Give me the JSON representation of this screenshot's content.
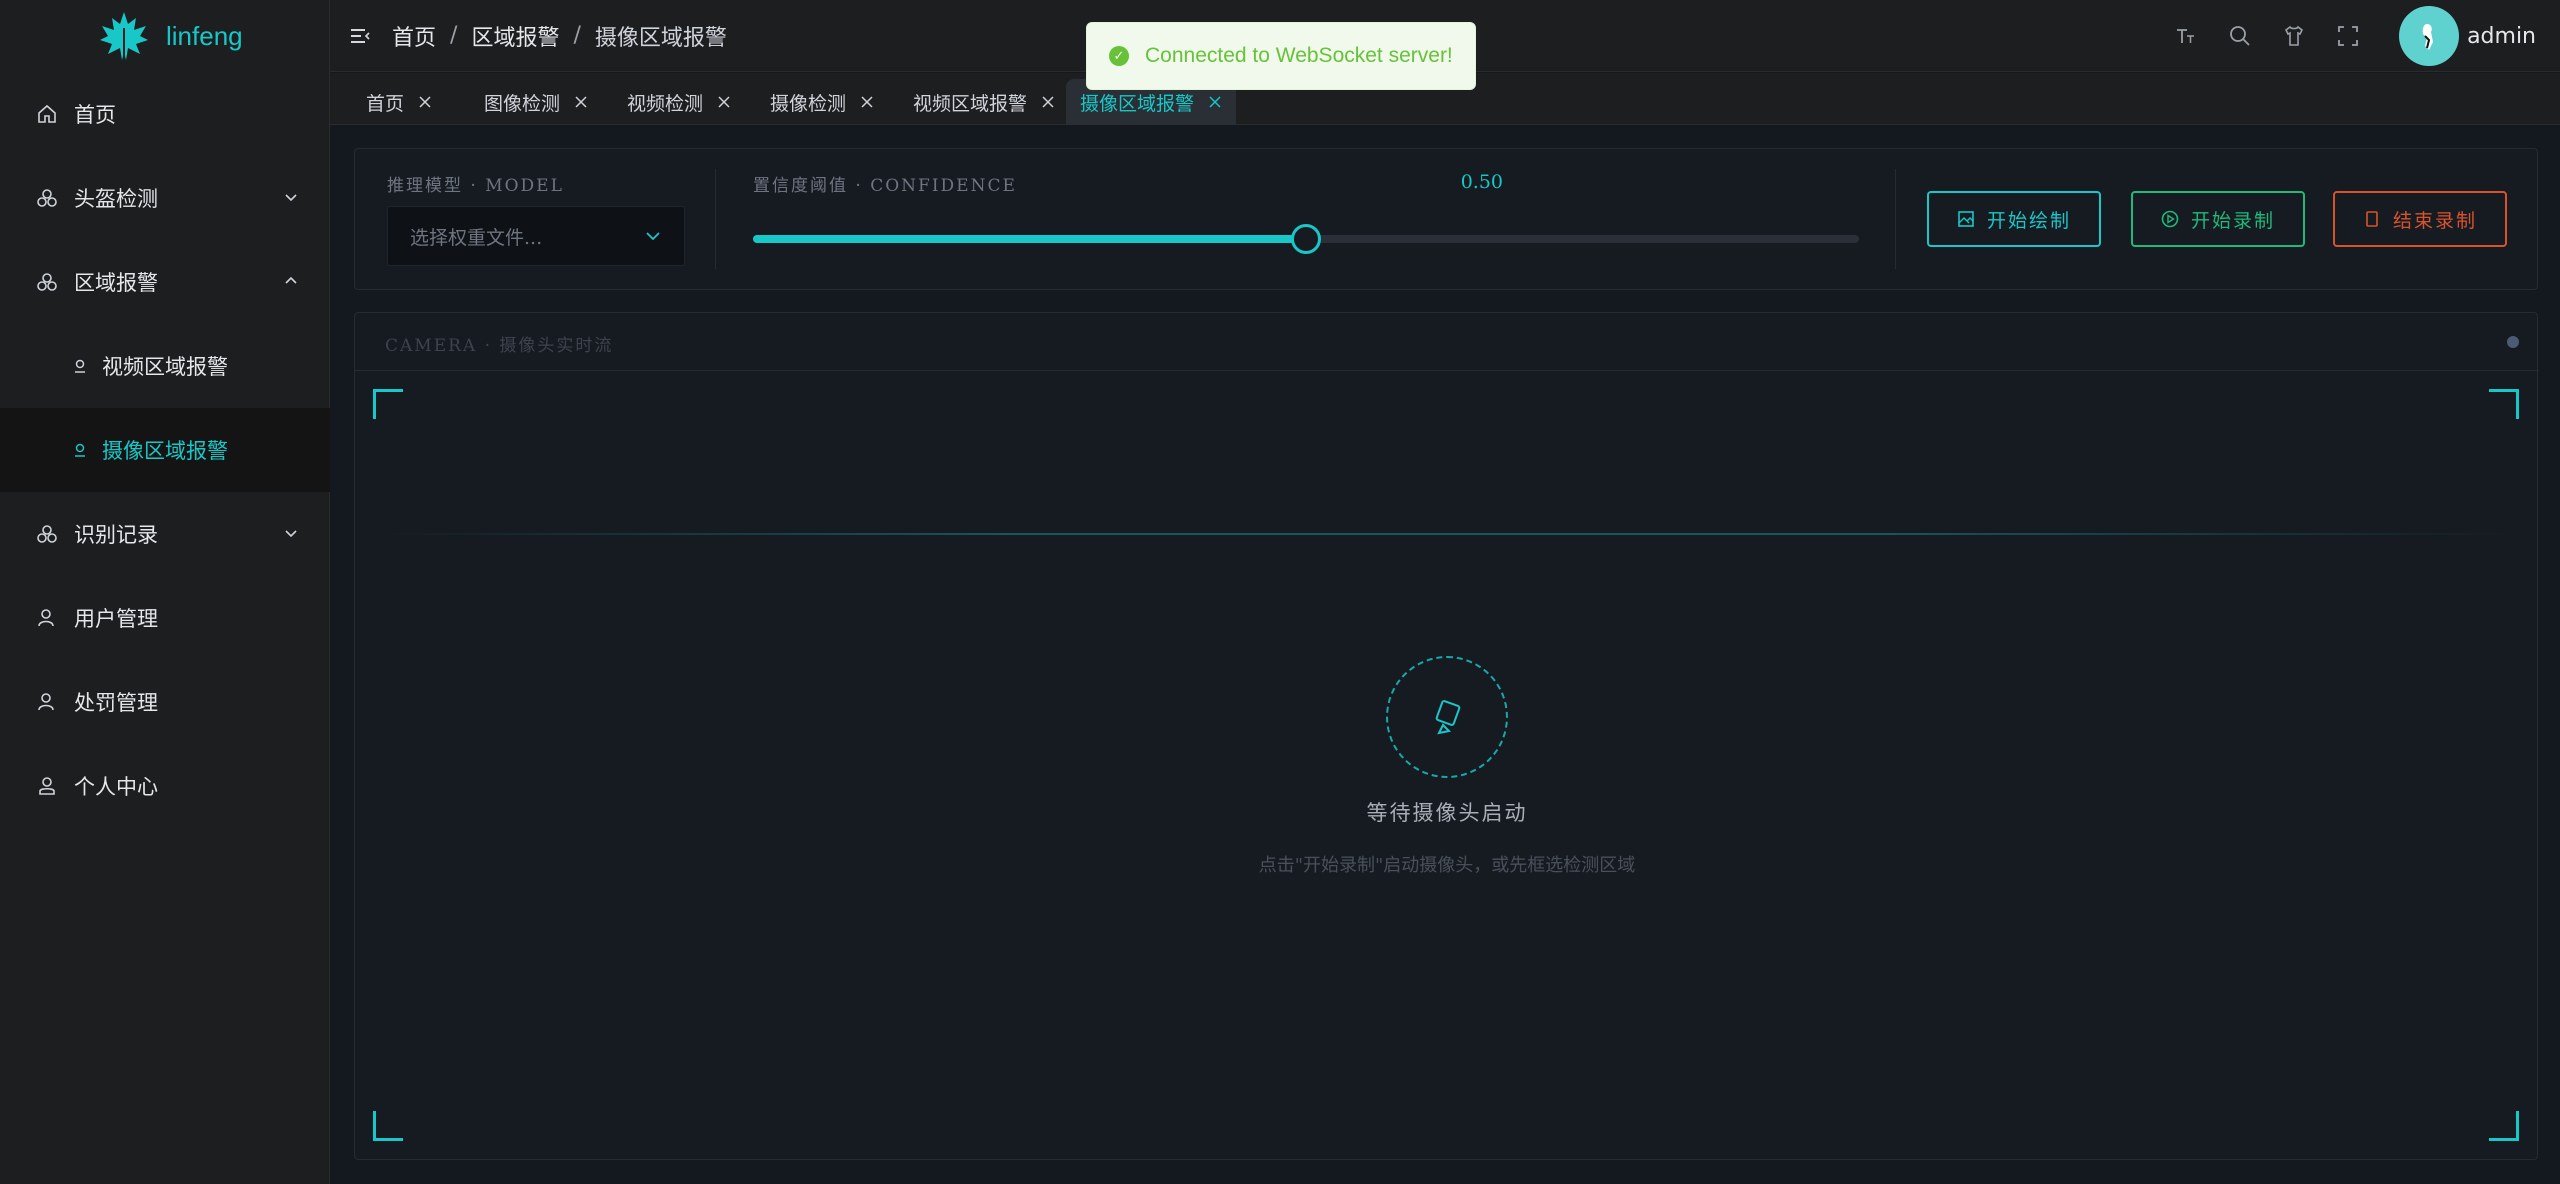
{
  "app": {
    "logo_text": "linfeng",
    "accent": "#18c7c7"
  },
  "sidebar": {
    "items": [
      {
        "label": "首页",
        "icon": "home-icon"
      },
      {
        "label": "头盔检测",
        "icon": "helmet-icon",
        "expandable": true,
        "expanded": false
      },
      {
        "label": "区域报警",
        "icon": "helmet-icon",
        "expandable": true,
        "expanded": true
      },
      {
        "label": "视频区域报警",
        "icon": "pin-icon",
        "sub": true
      },
      {
        "label": "摄像区域报警",
        "icon": "pin-icon",
        "sub": true,
        "active": true
      },
      {
        "label": "识别记录",
        "icon": "helmet-icon",
        "expandable": true,
        "expanded": false
      },
      {
        "label": "用户管理",
        "icon": "user-icon"
      },
      {
        "label": "处罚管理",
        "icon": "user-icon"
      },
      {
        "label": "个人中心",
        "icon": "profile-icon"
      }
    ]
  },
  "header": {
    "breadcrumb": [
      "首页",
      "区域报警",
      "摄像区域报警"
    ],
    "username": "admin",
    "icons": [
      "font-size-icon",
      "search-icon",
      "theme-icon",
      "fullscreen-icon"
    ]
  },
  "tabs": [
    {
      "label": "首页"
    },
    {
      "label": "图像检测"
    },
    {
      "label": "视频检测"
    },
    {
      "label": "摄像检测"
    },
    {
      "label": "视频区域报警"
    },
    {
      "label": "摄像区域报警",
      "active": true
    }
  ],
  "toast": {
    "text": "Connected to WebSocket server!",
    "color": "#67c23a"
  },
  "controls": {
    "model_label": "推理模型 · MODEL",
    "model_placeholder": "选择权重文件...",
    "confidence_label": "置信度阈值 · CONFIDENCE",
    "confidence_value": "0.50",
    "confidence_fraction": 0.5,
    "btn_draw": "开始绘制",
    "btn_start": "开始录制",
    "btn_stop": "结束录制"
  },
  "camera": {
    "title": "CAMERA · 摄像头实时流",
    "waiting": "等待摄像头启动",
    "hint": "点击\"开始录制\"启动摄像头，或先框选检测区域"
  }
}
